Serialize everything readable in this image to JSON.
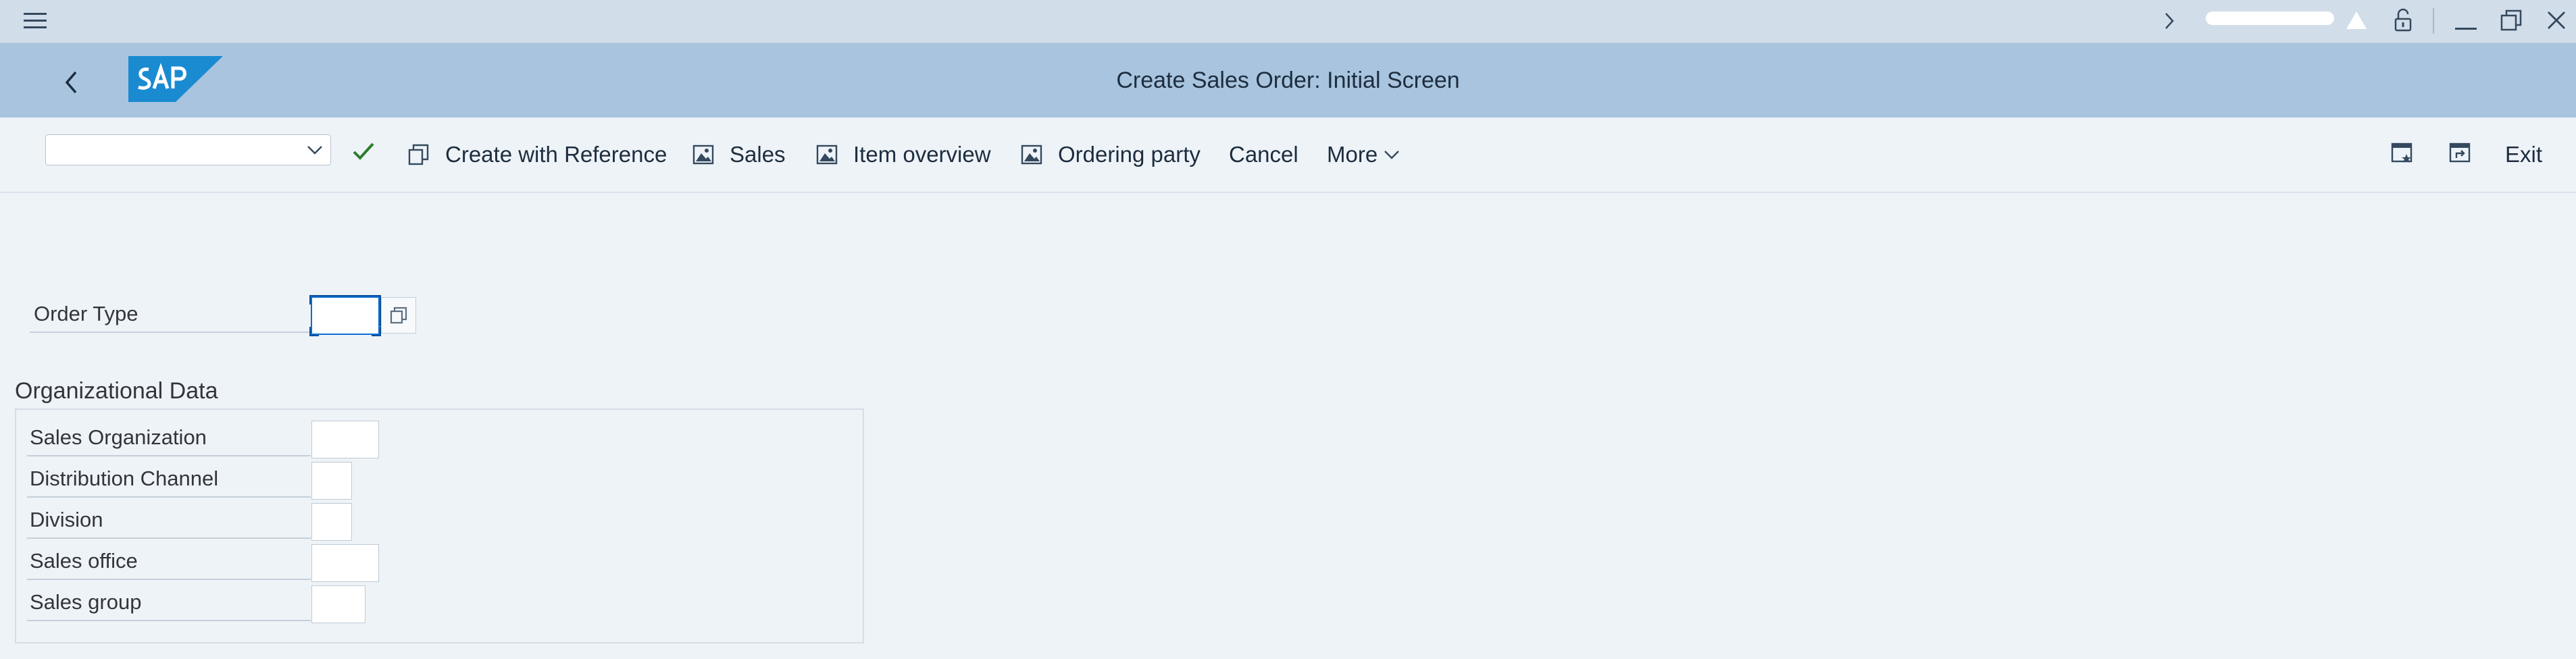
{
  "window": {
    "title": "Create Sales Order: Initial Screen"
  },
  "toolbar": {
    "command_field_value": "",
    "items": [
      {
        "label": "Create with Reference",
        "icon": "copy-icon"
      },
      {
        "label": "Sales",
        "icon": "image-icon"
      },
      {
        "label": "Item overview",
        "icon": "image-icon"
      },
      {
        "label": "Ordering party",
        "icon": "image-icon"
      },
      {
        "label": "Cancel"
      },
      {
        "label": "More",
        "icon": "chevron-down-icon"
      }
    ],
    "exit_label": "Exit"
  },
  "header_fields": {
    "order_type": {
      "label": "Order Type",
      "value": ""
    }
  },
  "organizational_data": {
    "title": "Organizational Data",
    "fields": [
      {
        "label": "Sales Organization",
        "value": ""
      },
      {
        "label": "Distribution Channel",
        "value": ""
      },
      {
        "label": "Division",
        "value": ""
      },
      {
        "label": "Sales office",
        "value": ""
      },
      {
        "label": "Sales group",
        "value": ""
      }
    ]
  },
  "colors": {
    "top_bar": "#d1dde9",
    "title_bar": "#a8c4de",
    "background": "#eef3f8",
    "check_green": "#2b7d2b",
    "sap_logo_blue": "#1a8bd1"
  }
}
